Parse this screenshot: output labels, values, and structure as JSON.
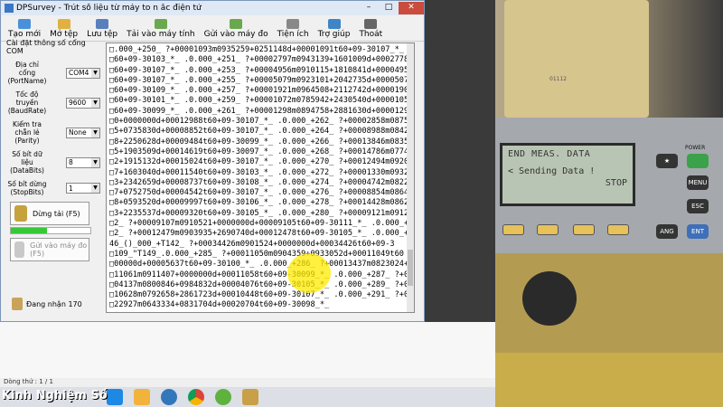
{
  "window": {
    "title": "DPSurvey - Trút số liệu từ máy to",
    "subtitle": "n ắc điện tử",
    "btn_min": "–",
    "btn_max": "□",
    "btn_close": "✕"
  },
  "toolbar": [
    {
      "label": "Tạo mới",
      "icon": "new-file-icon",
      "color": "#4a90d9"
    },
    {
      "label": "Mở tệp",
      "icon": "open-folder-icon",
      "color": "#e0b040"
    },
    {
      "label": "Lưu tệp",
      "icon": "save-icon",
      "color": "#5a7fbf"
    },
    {
      "label": "Tải vào máy tính",
      "icon": "download-icon",
      "color": "#6aa84f"
    },
    {
      "label": "Gửi vào máy đo",
      "icon": "upload-icon",
      "color": "#6aa84f"
    },
    {
      "label": "Tiện ích",
      "icon": "utility-icon",
      "color": "#888888"
    },
    {
      "label": "Trợ giúp",
      "icon": "help-icon",
      "color": "#3d85c6"
    },
    {
      "label": "Thoát",
      "icon": "exit-icon",
      "color": "#666666"
    }
  ],
  "settings": {
    "group_title": "Cài đặt thông số cổng COM",
    "fields": [
      {
        "label": "Địa chỉ cổng (PortName)",
        "value": "COM4"
      },
      {
        "label": "Tốc độ truyền (BaudRate)",
        "value": "9600"
      },
      {
        "label": "Kiểm tra chẵn lẻ (Parity)",
        "value": "None"
      },
      {
        "label": "Số bít dữ liệu (DataBits)",
        "value": "8"
      },
      {
        "label": "Số bít dừng (StopBits)",
        "value": "1"
      }
    ]
  },
  "actions": {
    "stop_label": "Dừng tải (F5)",
    "send_label": "Gửi vào máy đo (F5)",
    "progress": 0.45
  },
  "status": {
    "text": "Đang nhận 170"
  },
  "data_lines": [
    "□.000_+250_ ?+00001093m0935259+0251148d+00001091t60+09-30107_*_",
    "□60+09-30103_*_ .0.000_+251_ ?+00002797m0943139+1601009d+0002778",
    "□60+09-30107_*_ .0.000_+253_ ?+00004956m0910115+1810841d+00004955",
    "□60+09-30107_*_ .0.000_+255_ ?+00005079m0923101+2042735d+0000507",
    "□60+09-30109_*_ .0.000_+257_ ?+00001921m0964508+2112742d+00001909",
    "□60+09-30101_*_ .0.000_+259_ ?+00001072m0785942+2430540d+0000105",
    "□60+09-30099_*_ .0.000_+261_ ?+00001298m0894758+2881630d+0000129",
    "□0+0000000d+00012988t60+09-30107_*_ .0.000_+262_ ?+00002858m0875",
    "□5+0735830d+00008852t60+09-30107_*_ .0.000_+264_ ?+00008988m0842",
    "□8+2250628d+00009484t60+09-30099_*_ .0.000_+266_ ?+00013846m0835",
    "□5+1903509d+00014619t60+09-30097_*_ .0.000_+268_ ?+00014786m0774",
    "□2+1915132d+00015024t60+09-30107_*_ .0.000_+270_ ?+00012494m0920",
    "□7+1603040d+00011540t60+09-30103_*_ .0.000_+272_ ?+00001330m0932",
    "□3+2342659d+00008737t60+09-30108_*_ .0.000_+274_ ?+00004742m0822",
    "□7+0752750d+00004542t60+09-30107_*_ .0.000_+276_ ?+00008854m0864",
    "□8+0593520d+00009997t60+09-30106_*_ .0.000_+278_ ?+00014428m0862",
    "□3+2235537d+00009320t60+09-30105_*_ .0.000_+280_ ?+00009121m0912",
    "□2_ ?+00009107m0910521+0000000d+00009105t60+09-30111_*_ .0.000_+2",
    "□2_ ?+00012479m0903935+2690740d+00012478t60+09-30105_*_ .0.000_+2",
    "46_()_000_+T142_ ?+00034426m0901524+0000000d+00034426t60+09-3",
    "□109_\"T149_.0.000_+285_ ?+00011050m0904359+0933052d+00011049t60",
    "□00000d+00005637t60+09-30100_*_ .0.000_+286_ ?+00013437m0823024+",
    "□11061m0911407+0000000d+00011058t60+09-30099_*_ .0.000_+287_ ?+0",
    "□04137m0800846+0984832d+00004076t60+09-30105_*_ .0.000_+289_ ?+0",
    "□10628m0792658+2861723d+00010448t60+09-30107_*_ .0.000_+291_ ?+0",
    "□22927m0643334+0831704d+00020704t60+09-30098_*_"
  ],
  "statusbar": {
    "text": "Dòng thứ : 1 / 1"
  },
  "watermark": "Kinh Nghiệm Số",
  "instrument": {
    "serial": "01112",
    "screen_line1": "END MEAS. DATA",
    "screen_line2": "< Sending Data !",
    "screen_line3": "STOP",
    "power_label": "POWER",
    "keys": [
      "ESC",
      "ENT",
      "MENU",
      "ANG"
    ]
  }
}
